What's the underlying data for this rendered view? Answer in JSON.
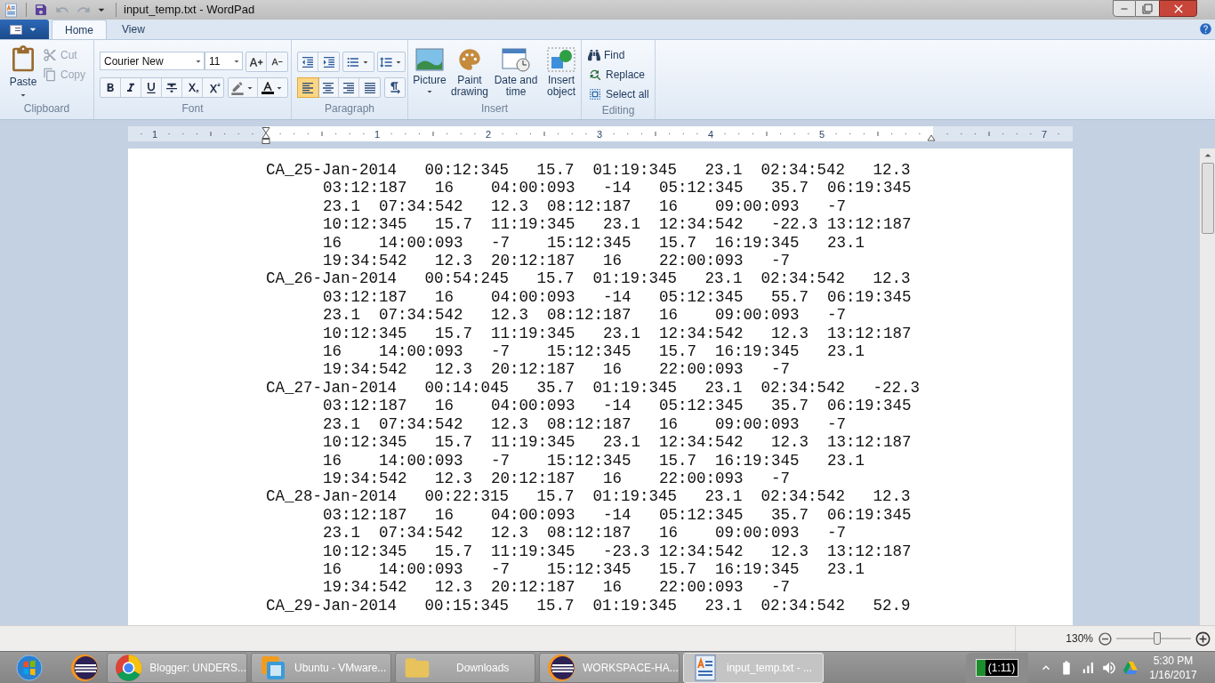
{
  "window": {
    "title": "input_temp.txt - WordPad"
  },
  "tabs": [
    {
      "label": "Home",
      "selected": true
    },
    {
      "label": "View",
      "selected": false
    }
  ],
  "ribbon": {
    "clipboard": {
      "label": "Clipboard",
      "paste": "Paste",
      "cut": {
        "label": "Cut",
        "disabled": true
      },
      "copy": {
        "label": "Copy",
        "disabled": true
      }
    },
    "font": {
      "label": "Font",
      "font_name": "Courier New",
      "font_size": "11"
    },
    "paragraph": {
      "label": "Paragraph",
      "align": [
        {
          "selected": true
        },
        {
          "selected": false
        },
        {
          "selected": false
        },
        {
          "selected": false
        }
      ]
    },
    "insert": {
      "label": "Insert",
      "items": [
        {
          "label": "Picture",
          "dropdown": true
        },
        {
          "label": "Paint drawing",
          "dropdown": false
        },
        {
          "label": "Date and time",
          "dropdown": false
        },
        {
          "label": "Insert object",
          "dropdown": false
        }
      ]
    },
    "editing": {
      "label": "Editing",
      "items": [
        "Find",
        "Replace",
        "Select all"
      ]
    }
  },
  "ruler": {
    "labels": [
      "1",
      "1",
      "2",
      "3",
      "4",
      "5",
      "7"
    ]
  },
  "document": {
    "paragraphs": [
      {
        "lines": [
          "CA_25-Jan-2014   00:12:345   15.7  01:19:345   23.1  02:34:542   12.3",
          "03:12:187   16    04:00:093   -14   05:12:345   35.7  06:19:345",
          "23.1  07:34:542   12.3  08:12:187   16    09:00:093   -7",
          "10:12:345   15.7  11:19:345   23.1  12:34:542   -22.3 13:12:187",
          "16    14:00:093   -7    15:12:345   15.7  16:19:345   23.1",
          "19:34:542   12.3  20:12:187   16    22:00:093   -7"
        ]
      },
      {
        "lines": [
          "CA_26-Jan-2014   00:54:245   15.7  01:19:345   23.1  02:34:542   12.3",
          "03:12:187   16    04:00:093   -14   05:12:345   55.7  06:19:345",
          "23.1  07:34:542   12.3  08:12:187   16    09:00:093   -7",
          "10:12:345   15.7  11:19:345   23.1  12:34:542   12.3  13:12:187",
          "16    14:00:093   -7    15:12:345   15.7  16:19:345   23.1",
          "19:34:542   12.3  20:12:187   16    22:00:093   -7"
        ]
      },
      {
        "lines": [
          "CA_27-Jan-2014   00:14:045   35.7  01:19:345   23.1  02:34:542   -22.3",
          "03:12:187   16    04:00:093   -14   05:12:345   35.7  06:19:345",
          "23.1  07:34:542   12.3  08:12:187   16    09:00:093   -7",
          "10:12:345   15.7  11:19:345   23.1  12:34:542   12.3  13:12:187",
          "16    14:00:093   -7    15:12:345   15.7  16:19:345   23.1",
          "19:34:542   12.3  20:12:187   16    22:00:093   -7"
        ]
      },
      {
        "lines": [
          "CA_28-Jan-2014   00:22:315   15.7  01:19:345   23.1  02:34:542   12.3",
          "03:12:187   16    04:00:093   -14   05:12:345   35.7  06:19:345",
          "23.1  07:34:542   12.3  08:12:187   16    09:00:093   -7",
          "10:12:345   15.7  11:19:345   -23.3 12:34:542   12.3  13:12:187",
          "16    14:00:093   -7    15:12:345   15.7  16:19:345   23.1",
          "19:34:542   12.3  20:12:187   16    22:00:093   -7"
        ]
      },
      {
        "lines": [
          "CA_29-Jan-2014   00:15:345   15.7  01:19:345   23.1  02:34:542   52.9"
        ]
      }
    ]
  },
  "status_bar": {
    "zoom": "130%",
    "zoom_slider": {
      "level": 0.55
    }
  },
  "taskbar": {
    "items": [
      {
        "kind": "pinned",
        "selected": false
      },
      {
        "kind": "window",
        "label": "Blogger: UNDERS...",
        "selected": false
      },
      {
        "kind": "window",
        "label": "Ubuntu - VMware...",
        "selected": false
      },
      {
        "kind": "window",
        "label": "Downloads",
        "selected": false
      },
      {
        "kind": "window",
        "label": "WORKSPACE-HA...",
        "selected": false
      },
      {
        "kind": "window",
        "label": "input_temp.txt - ...",
        "selected": true
      }
    ],
    "battery": "(1:11)",
    "time": "5:30 PM",
    "date": "1/16/2017"
  }
}
